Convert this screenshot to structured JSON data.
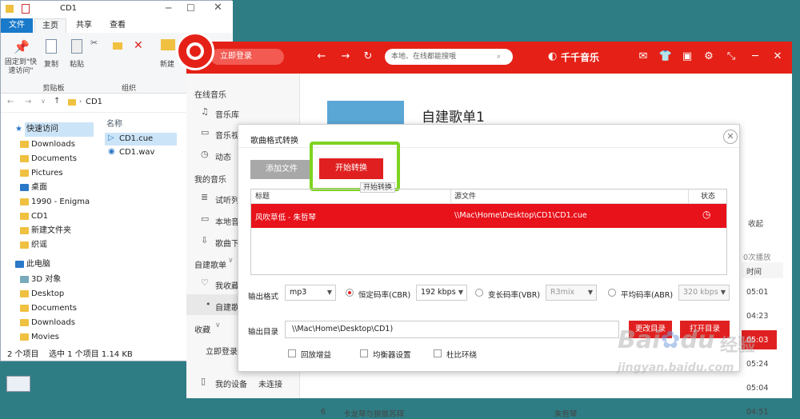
{
  "explorer": {
    "title": "CD1",
    "tabs": [
      "文件",
      "主页",
      "共享",
      "查看"
    ],
    "ribbon": {
      "pin_label": "固定到\"快速访问\"",
      "copy_label": "复制",
      "paste_label": "粘贴",
      "new_label": "新建",
      "group_clipboard": "剪贴板",
      "group_organize": "组织"
    },
    "address": "CD1",
    "nav": [
      "快速访问",
      "Downloads",
      "Documents",
      "Pictures",
      "桌面",
      "1990 - Enigma",
      "CD1",
      "新建文件夹",
      "织谣",
      "此电脑",
      "3D 对象",
      "Desktop",
      "Documents",
      "Downloads",
      "Movies"
    ],
    "files_header": "名称",
    "files": [
      "CD1.cue",
      "CD1.wav"
    ],
    "status": {
      "count": "2 个项目",
      "selected": "选中 1 个项目 1.14 KB"
    }
  },
  "app": {
    "login": "立即登录",
    "search_placeholder": "本地、在线都能搜哦",
    "brand": "千千音乐",
    "sidebar": {
      "sec_online": "在线音乐",
      "online_items": [
        "音乐库",
        "音乐视"
      ],
      "dynamic": "动态",
      "sec_mine": "我的音乐",
      "mine_items": [
        "试听列",
        "本地音",
        "歌曲下"
      ],
      "sec_playlists": "自建歌单",
      "playlist_items": [
        "我收藏",
        "自建歌"
      ],
      "sec_collect": "收藏",
      "login_now": "立即登录",
      "device": "我的设备",
      "device_status": "未连接"
    },
    "playlist_title": "自建歌单1",
    "right_col": {
      "collapse": "收起",
      "plays": "0次播放",
      "time_header": "时间",
      "times": [
        "05:01",
        "04:23",
        "05:03",
        "05:24",
        "05:04",
        "04:51"
      ]
    },
    "bg_row": {
      "num": "6",
      "title": "卡龙琴与狼狼苏拜",
      "artist": "朱哲琴"
    }
  },
  "dialog": {
    "title": "歌曲格式转换",
    "add_file": "添加文件",
    "start": "开始转换",
    "tooltip": "开始转换",
    "columns": {
      "title": "标题",
      "source": "源文件",
      "status": "状态"
    },
    "rows": [
      {
        "title": "风吹草低 - 朱哲琴",
        "source": "\\\\Mac\\Home\\Desktop\\CD1\\CD1.cue"
      }
    ],
    "format_label": "输出格式",
    "format_value": "mp3",
    "cbr_label": "恒定码率(CBR)",
    "cbr_value": "192 kbps",
    "vbr_label": "变长码率(VBR)",
    "vbr_value": "R3mix",
    "abr_label": "平均码率(ABR)",
    "abr_value": "320 kbps",
    "dir_label": "输出目录",
    "dir_value": "\\\\Mac\\Home\\Desktop\\CD1)",
    "change_dir": "更改目录",
    "open_dir": "打开目录",
    "opt_gain": "回放增益",
    "opt_eq": "均衡器设置",
    "opt_ratio": "杜比环绕"
  },
  "watermark": {
    "brand": "Bai",
    "brand2": "du",
    "cn": "经验",
    "url": "jingyan.baidu.com"
  }
}
